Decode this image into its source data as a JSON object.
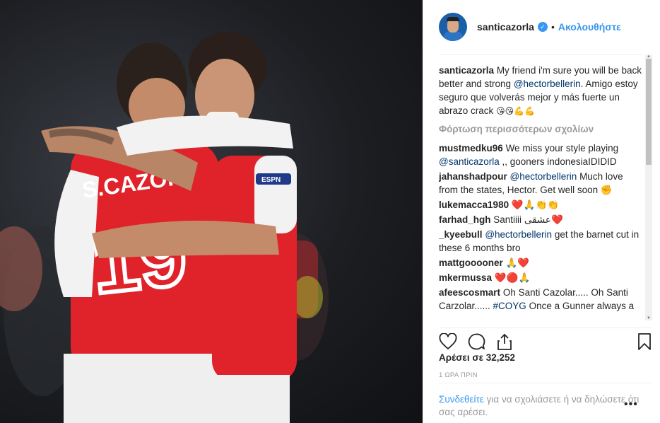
{
  "header": {
    "username": "santicazorla",
    "separator": "•",
    "follow_label": "Ακολουθήστε"
  },
  "caption": {
    "username": "santicazorla",
    "text_before": "My friend i'm sure you will be back better and strong",
    "mention": "@hectorbellerin",
    "text_after": ". Amigo estoy seguro que volverás mejor y más fuerte un abrazo crack",
    "emojis": "😘😘💪💪"
  },
  "load_more": "Φόρτωση περισσότερων σχολίων",
  "comments": [
    {
      "user": "mustmedku96",
      "pre": "We miss your style playing",
      "mention": "@santicazorla",
      "post": ",, gooners indonesiaIDIDID"
    },
    {
      "user": "jahanshadpour",
      "pre": "",
      "mention": "@hectorbellerin",
      "post": "Much love from the states, Hector. Get well soon ✊"
    },
    {
      "user": "lukemacca1980",
      "pre": "",
      "mention": "",
      "post": "❤️🙏👏👏"
    },
    {
      "user": "farhad_hgh",
      "pre": "",
      "mention": "",
      "post": "Santiiii عشقی❤️"
    },
    {
      "user": "_kyeebull",
      "pre": "",
      "mention": "@hectorbellerin",
      "post": "get the barnet cut in these 6 months bro"
    },
    {
      "user": "mattgooooner",
      "pre": "",
      "mention": "",
      "post": "🙏❤️"
    },
    {
      "user": "mkermussa",
      "pre": "",
      "mention": "",
      "post": "❤️🔴🙏"
    },
    {
      "user": "afeescosmart",
      "pre": "Oh Santi Cazolar..... Oh Santi Carzolar......",
      "mention": "#COYG",
      "post": "Once a Gunner always a"
    }
  ],
  "likes_text": "Αρέσει σε 32,252",
  "timestamp": "1 ΩΡΑ ΠΡΙΝ",
  "footer": {
    "login_link": "Συνδεθείτε",
    "text": "για να σχολιάσετε ή να δηλώσετε ότι σας αρέσει."
  },
  "more_options": "•••",
  "photo": {
    "jersey_name": "S.CAZOR",
    "jersey_number": "19",
    "badge_text": "ESPN"
  },
  "colors": {
    "accent": "#3897f0",
    "link": "#003569",
    "muted": "#999999",
    "arsenal_red": "#e0232b"
  },
  "icons": [
    "heart-icon",
    "comment-icon",
    "share-icon",
    "bookmark-icon",
    "verified-icon",
    "more-options-icon"
  ]
}
